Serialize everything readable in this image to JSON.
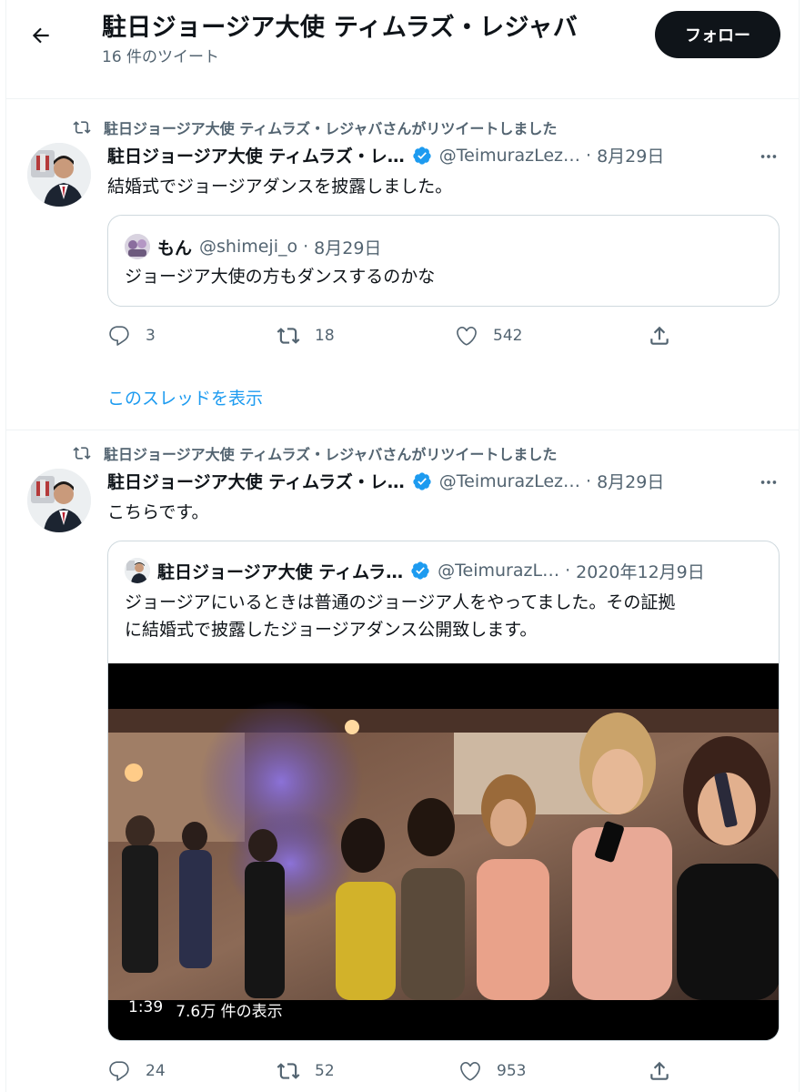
{
  "header": {
    "title": "駐日ジョージア大使 ティムラズ・レジャバ",
    "subtitle": "16 件のツイート",
    "follow_label": "フォロー"
  },
  "tweets": [
    {
      "retweet_label": "駐日ジョージア大使 ティムラズ・レジャバさんがリツイートしました",
      "name": "駐日ジョージア大使 ティムラズ・レ…",
      "handle": "@TeimurazLez…",
      "date": "8月29日",
      "text": "結婚式でジョージアダンスを披露しました。",
      "quote": {
        "name": "もん",
        "handle": "@shimeji_o",
        "date": "8月29日",
        "text": "ジョージア大使の方もダンスするのかな"
      },
      "replies": "3",
      "retweets": "18",
      "likes": "542",
      "show_thread": "このスレッドを表示"
    },
    {
      "retweet_label": "駐日ジョージア大使 ティムラズ・レジャバさんがリツイートしました",
      "name": "駐日ジョージア大使 ティムラズ・レ…",
      "handle": "@TeimurazLez…",
      "date": "8月29日",
      "text": "こちらです。",
      "quote": {
        "name": "駐日ジョージア大使 ティムラ…",
        "handle": "@TeimurazL…",
        "date": "2020年12月9日",
        "text_line1": "ジョージアにいるときは普通のジョージア人をやってました。その証拠",
        "text_line2": "に結婚式で披露したジョージアダンス公開致します。",
        "video_duration": "1:39",
        "video_views": "7.6万 件の表示"
      },
      "replies": "24",
      "retweets": "52",
      "likes": "953"
    }
  ],
  "colors": {
    "accent": "#1d9bf0",
    "text": "#0f1419",
    "secondary": "#536471",
    "border": "#cfd9de"
  }
}
